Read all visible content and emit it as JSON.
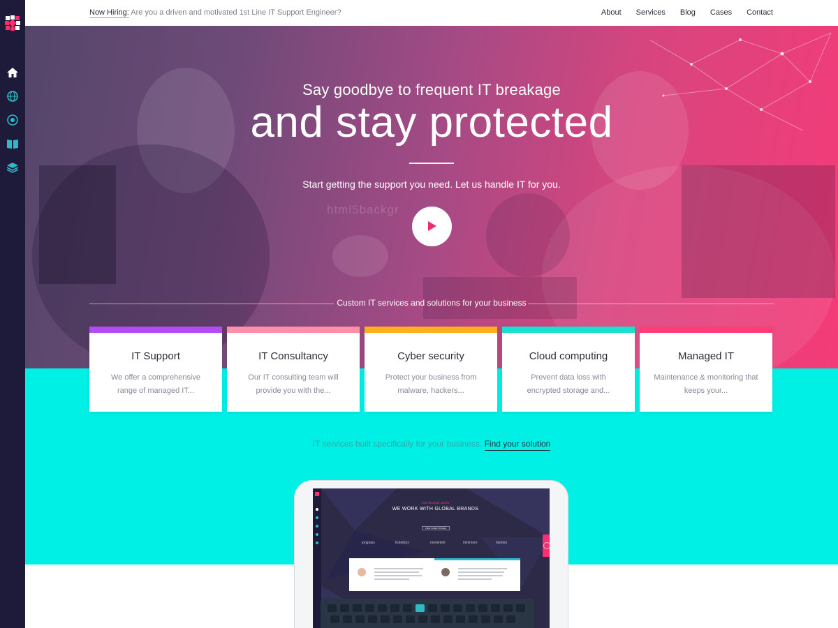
{
  "topbar": {
    "hiring_label": "Now Hiring:",
    "hiring_text": " Are you a driven and motivated 1st Line IT Support Engineer?",
    "nav": [
      "About",
      "Services",
      "Blog",
      "Cases",
      "Contact"
    ]
  },
  "sidebar": {
    "icons": [
      "home-icon",
      "globe-icon",
      "network-icon",
      "book-icon",
      "layers-icon"
    ]
  },
  "hero": {
    "subtitle": "Say goodbye to frequent IT breakage",
    "title": "and stay protected",
    "tagline": "Start getting the support you need. Let us handle IT for you.",
    "watermark": "html5backgr"
  },
  "services": {
    "label": "Custom IT services and solutions for your business",
    "cards": [
      {
        "title": "IT Support",
        "desc": "We offer a comprehensive range of managed IT...",
        "color": "#b44cf4"
      },
      {
        "title": "IT Consultancy",
        "desc": "Our IT consulting team will provide you with the...",
        "color": "#ff8ea8"
      },
      {
        "title": "Cyber security",
        "desc": "Protect your business from malware, hackers...",
        "color": "#ffae1e"
      },
      {
        "title": "Cloud computing",
        "desc": "Prevent data loss with encrypted storage and...",
        "color": "#15e3cf"
      },
      {
        "title": "Managed IT",
        "desc": "Maintenance & monitoring that keeps your...",
        "color": "#ff3c78"
      }
    ]
  },
  "cta": {
    "text": "IT services built specifically for your business.",
    "link": "Find your solution"
  },
  "tablet": {
    "kicker": "OUR RECENT WORK",
    "headline": "WE WORK WITH GLOBAL BRANDS",
    "button": "VIEW CASE STUDIES",
    "brands": [
      "jongrass",
      "ticketbox",
      "movemint",
      "minimore",
      "fashion"
    ]
  },
  "colors": {
    "sidebar": "#1e1b3a",
    "accent_pink": "#f43b78",
    "accent_cyan": "#00f0e6"
  }
}
